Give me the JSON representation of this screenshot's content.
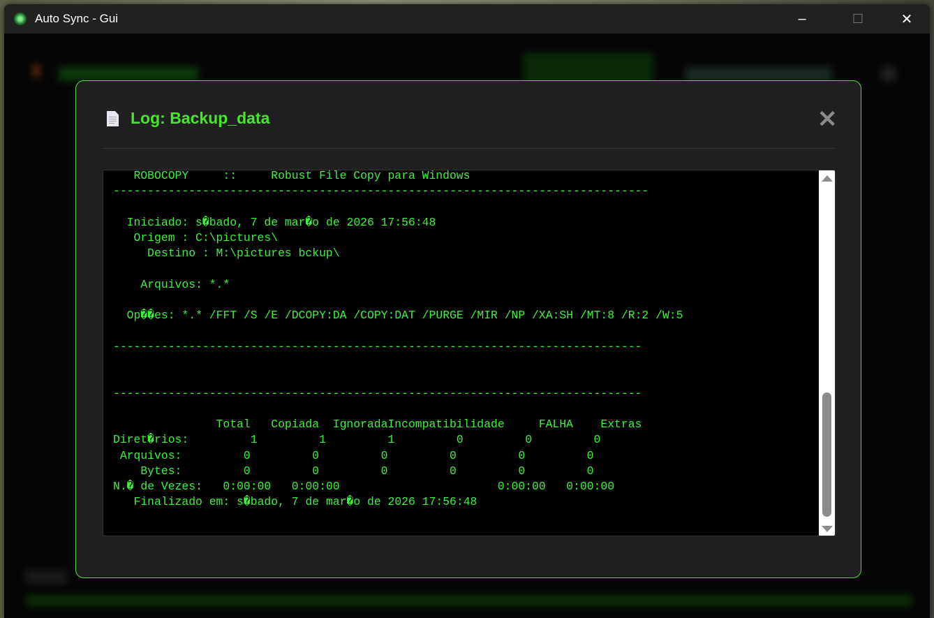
{
  "window": {
    "title": "Auto Sync - Gui",
    "minimize": "–",
    "maximize": "☐",
    "close": "✕"
  },
  "modal": {
    "icon": "document-icon",
    "title": "Log: Backup_data",
    "close": "✕",
    "log_lines": [
      "   ROBOCOPY     ::     Robust File Copy para Windows",
      "------------------------------------------------------------------------------",
      "",
      "  Iniciado: s�bado, 7 de mar�o de 2026 17:56:48",
      "   Origem : C:\\pictures\\",
      "     Destino : M:\\pictures bckup\\",
      "",
      "    Arquivos: *.*",
      "",
      "  Op��es: *.* /FFT /S /E /DCOPY:DA /COPY:DAT /PURGE /MIR /NP /XA:SH /MT:8 /R:2 /W:5",
      "",
      "-----------------------------------------------------------------------------",
      "",
      "",
      "-----------------------------------------------------------------------------",
      "",
      "               Total   Copiada  IgnoradaIncompatibilidade     FALHA    Extras",
      "Diret�rios:         1         1         1         0         0         0",
      " Arquivos:         0         0         0         0         0         0",
      "    Bytes:         0         0         0         0         0         0",
      "N.� de Vezes:   0:00:00   0:00:00                       0:00:00   0:00:00",
      "   Finalizado em: s�bado, 7 de mar�o de 2026 17:56:48"
    ]
  },
  "colors": {
    "accent": "#47e62b",
    "log_text": "#3af23a",
    "modal_bg": "#202020"
  }
}
